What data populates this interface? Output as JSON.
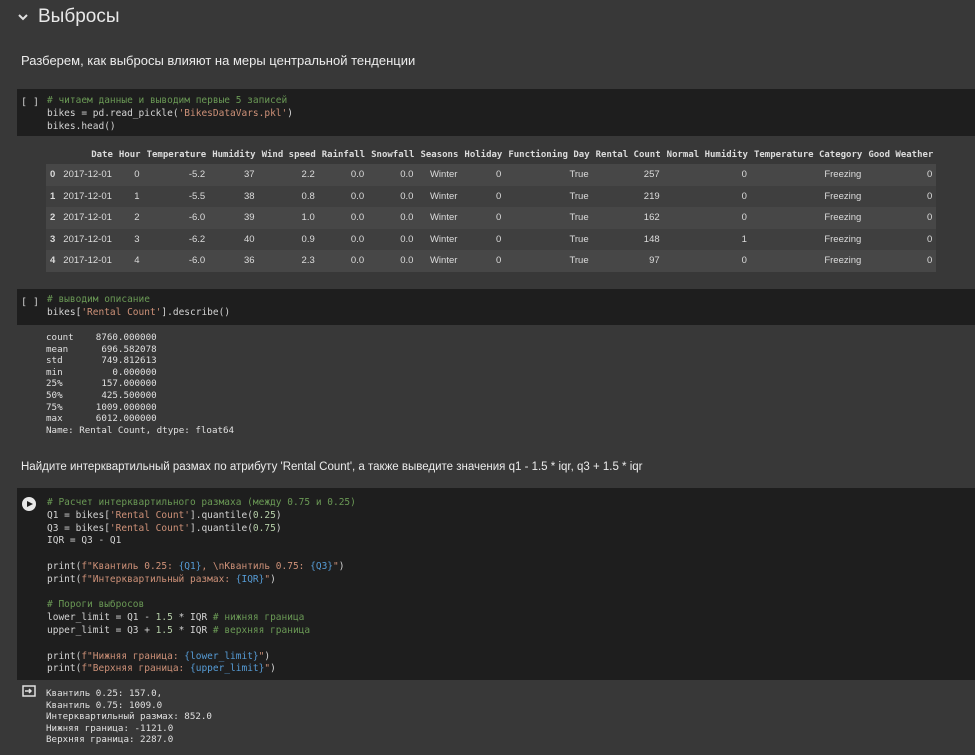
{
  "section": {
    "title": "Выбросы"
  },
  "md1": "Разберем, как выбросы влияют на меры центральной тенденции",
  "md2": "Найдите интерквартильный размах по атрибуту 'Rental Count', а также выведите значения q1 - 1.5 * iqr, q3 + 1.5 * iqr",
  "cell1": {
    "gutter": "[ ]",
    "comment": "# читаем данные и выводим первые 5 записей",
    "line2_pre": "bikes = pd.read_pickle(",
    "line2_str": "'BikesDataVars.pkl'",
    "line2_post": ")",
    "line3": "bikes.head()"
  },
  "table": {
    "columns": [
      "",
      "Date",
      "Hour",
      "Temperature",
      "Humidity",
      "Wind speed",
      "Rainfall",
      "Snowfall",
      "Seasons",
      "Holiday",
      "Functioning Day",
      "Rental Count",
      "Normal Humidity",
      "Temperature Category",
      "Good Weather"
    ],
    "rows": [
      [
        "0",
        "2017-12-01",
        "0",
        "-5.2",
        "37",
        "2.2",
        "0.0",
        "0.0",
        "Winter",
        "0",
        "True",
        "257",
        "0",
        "Freezing",
        "0"
      ],
      [
        "1",
        "2017-12-01",
        "1",
        "-5.5",
        "38",
        "0.8",
        "0.0",
        "0.0",
        "Winter",
        "0",
        "True",
        "219",
        "0",
        "Freezing",
        "0"
      ],
      [
        "2",
        "2017-12-01",
        "2",
        "-6.0",
        "39",
        "1.0",
        "0.0",
        "0.0",
        "Winter",
        "0",
        "True",
        "162",
        "0",
        "Freezing",
        "0"
      ],
      [
        "3",
        "2017-12-01",
        "3",
        "-6.2",
        "40",
        "0.9",
        "0.0",
        "0.0",
        "Winter",
        "0",
        "True",
        "148",
        "1",
        "Freezing",
        "0"
      ],
      [
        "4",
        "2017-12-01",
        "4",
        "-6.0",
        "36",
        "2.3",
        "0.0",
        "0.0",
        "Winter",
        "0",
        "True",
        "97",
        "0",
        "Freezing",
        "0"
      ]
    ]
  },
  "cell2": {
    "gutter": "[ ]",
    "comment": "# выводим описание",
    "line2_pre": "bikes[",
    "line2_str": "'Rental Count'",
    "line2_post": "].describe()"
  },
  "describe_output": "count    8760.000000\nmean      696.582078\nstd       749.812613\nmin         0.000000\n25%       157.000000\n50%       425.500000\n75%      1009.000000\nmax      6012.000000\nName: Rental Count, dtype: float64",
  "cell3": {
    "l1": "# Расчет интерквартильного размаха (между 0.75 и 0.25)",
    "l2a": "Q1 = bikes[",
    "l2s": "'Rental Count'",
    "l2b": "].quantile(",
    "l2n": "0.25",
    "l2c": ")",
    "l3a": "Q3 = bikes[",
    "l3s": "'Rental Count'",
    "l3b": "].quantile(",
    "l3n": "0.75",
    "l3c": ")",
    "l4": "IQR = Q3 - Q1",
    "l6a": "print(",
    "l6s1": "f\"Квантиль 0.25: ",
    "l6v1": "{Q1}",
    "l6s2": ", \\nКвантиль 0.75: ",
    "l6v2": "{Q3}",
    "l6s3": "\"",
    "l6c": ")",
    "l7a": "print(",
    "l7s1": "f\"Интерквартильный размах: ",
    "l7v1": "{IQR}",
    "l7s2": "\"",
    "l7c": ")",
    "l9": "# Пороги выбросов",
    "l10a": "lower_limit = Q1 - ",
    "l10n": "1.5",
    "l10b": " * IQR ",
    "l10c": "# нижняя граница",
    "l11a": "upper_limit = Q3 + ",
    "l11n": "1.5",
    "l11b": " * IQR ",
    "l11c": "# верхняя граница",
    "l13a": "print(",
    "l13s1": "f\"Нижняя граница: ",
    "l13v": "{lower_limit}",
    "l13s2": "\"",
    "l13c": ")",
    "l14a": "print(",
    "l14s1": "f\"Верхняя граница: ",
    "l14v": "{upper_limit}",
    "l14s2": "\"",
    "l14c": ")"
  },
  "final_output": "Квантиль 0.25: 157.0,\nКвантиль 0.75: 1009.0\nИнтерквартильный размах: 852.0\nНижняя граница: -1121.0\nВерхняя граница: 2287.0",
  "icons": {
    "collapse": "chevron-down-icon",
    "run": "play-icon",
    "output": "output-arrow-icon"
  }
}
